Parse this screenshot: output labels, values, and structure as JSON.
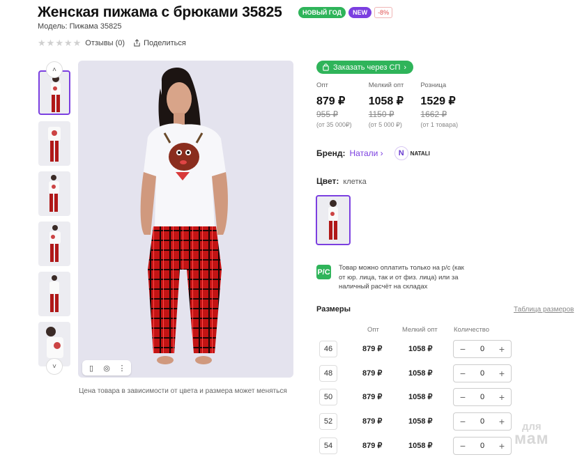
{
  "product": {
    "title": "Женская пижама с брюками 35825",
    "model": "Модель: Пижама 35825",
    "badges": {
      "new_year": "НОВЫЙ ГОД",
      "new": "NEW",
      "discount": "-8%"
    },
    "rating": {
      "stars": 0,
      "reviews": "Отзывы (0)",
      "share": "Поделиться"
    }
  },
  "gallery": {
    "thumbs_count": 6,
    "price_note": "Цена товара в зависимости от цвета и размера может меняться"
  },
  "order": {
    "sp_button": "Заказать через СП"
  },
  "prices": [
    {
      "label": "Опт",
      "value": "879 ₽",
      "old": "955 ₽",
      "note": "(от 35 000₽)"
    },
    {
      "label": "Мелкий опт",
      "value": "1058 ₽",
      "old": "1150 ₽",
      "note": "(от 5 000 ₽)"
    },
    {
      "label": "Розница",
      "value": "1529 ₽",
      "old": "1662 ₽",
      "note": "(от 1 товара)"
    }
  ],
  "brand": {
    "label": "Бренд:",
    "value": "Натали",
    "logo_letter": "N",
    "logo_text": "NATALI"
  },
  "color": {
    "label": "Цвет:",
    "value": "клетка"
  },
  "payment": {
    "icon": "Р/С",
    "text": "Товар можно оплатить только на р/с (как от юр. лица, так и от физ. лица) или за наличный расчёт на складах"
  },
  "sizes": {
    "title": "Размеры",
    "table_link": "Таблица размеров",
    "headers": {
      "opt": "Опт",
      "small_opt": "Мелкий опт",
      "qty": "Количество"
    },
    "rows": [
      {
        "size": "46",
        "opt": "879 ₽",
        "small_opt": "1058 ₽",
        "qty": "0"
      },
      {
        "size": "48",
        "opt": "879 ₽",
        "small_opt": "1058 ₽",
        "qty": "0"
      },
      {
        "size": "50",
        "opt": "879 ₽",
        "small_opt": "1058 ₽",
        "qty": "0"
      },
      {
        "size": "52",
        "opt": "879 ₽",
        "small_opt": "1058 ₽",
        "qty": "0"
      },
      {
        "size": "54",
        "opt": "879 ₽",
        "small_opt": "1058 ₽",
        "qty": "0"
      }
    ]
  },
  "watermark": {
    "line1": "для",
    "line2": "мам"
  },
  "colors": {
    "accent": "#7b3fe0",
    "green": "#2fb45a"
  }
}
